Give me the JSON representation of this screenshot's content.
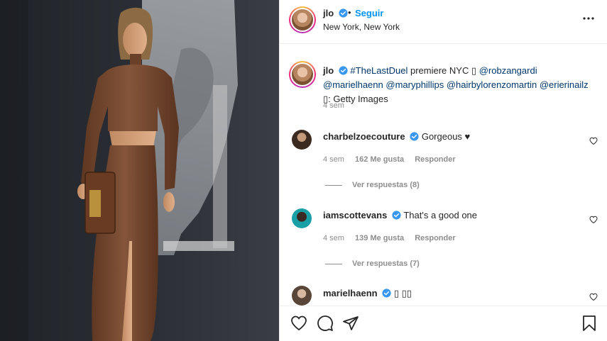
{
  "post": {
    "username": "jlo",
    "follow_label": "Seguir",
    "separator": "•",
    "location": "New York, New York"
  },
  "caption": {
    "username": "jlo",
    "hashtag": "#TheLastDuel",
    "text_1": " premiere NYC ",
    "glyph_1": "▯",
    "mention_1": "@robzangardi",
    "mention_2": "@marielhaenn",
    "mention_3": "@maryphillips",
    "mention_4": "@hairbylorenzomartin",
    "mention_5": "@erierinailz",
    "glyph_2": "▯",
    "text_2": ": Getty Images",
    "time": "4 sem"
  },
  "comments": [
    {
      "username": "charbelzoecouture",
      "text": "Gorgeous ♥",
      "time": "4 sem",
      "likes": "162 Me gusta",
      "reply": "Responder",
      "view_replies": "Ver respuestas (8)"
    },
    {
      "username": "iamscottevans",
      "text": "That's a good one",
      "time": "4 sem",
      "likes": "139 Me gusta",
      "reply": "Responder",
      "view_replies": "Ver respuestas (7)"
    },
    {
      "username": "marielhaenn",
      "text": "▯ ▯▯"
    }
  ],
  "icons": {
    "verified": "verified-badge-icon",
    "more": "more-options-icon",
    "like": "heart-icon",
    "comment": "comment-icon",
    "share": "share-icon",
    "save": "bookmark-icon"
  },
  "colors": {
    "link": "#00376b",
    "follow": "#0095f6",
    "verified": "#3897f0",
    "muted": "#8e8e8e"
  }
}
